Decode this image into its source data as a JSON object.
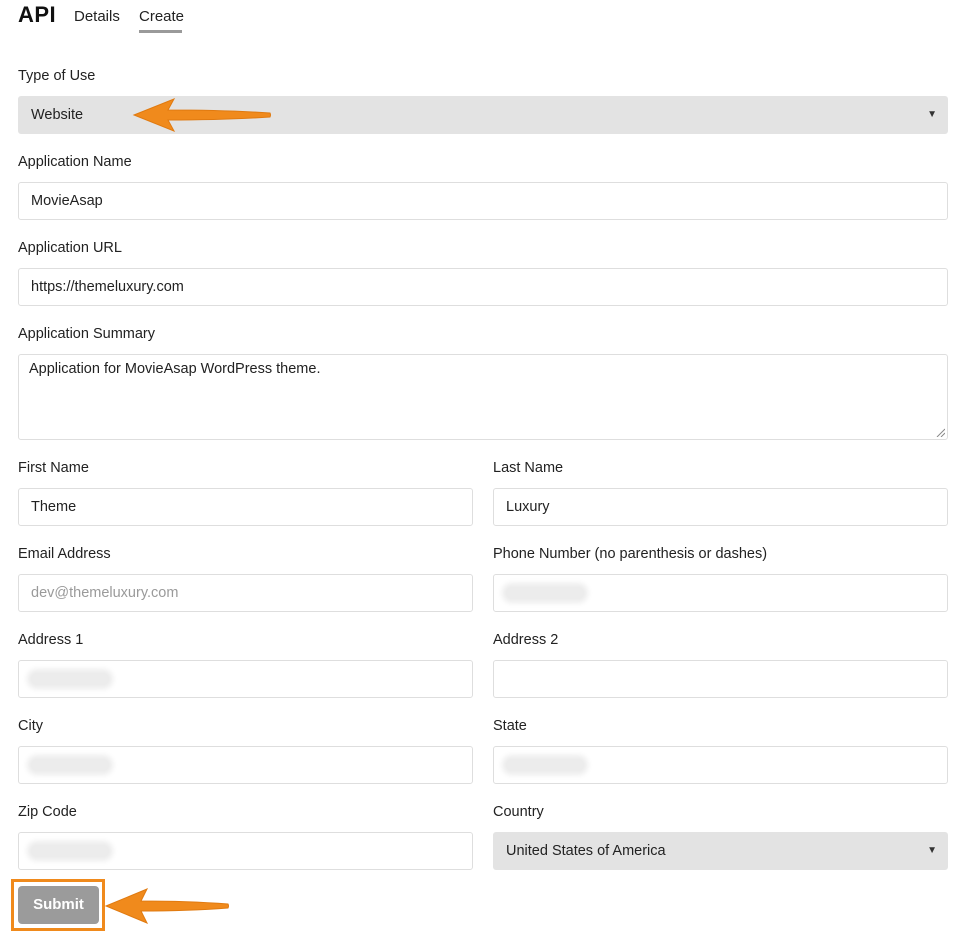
{
  "header": {
    "title": "API",
    "tabs": [
      {
        "label": "Details"
      },
      {
        "label": "Create",
        "active": true
      }
    ]
  },
  "form": {
    "type_of_use": {
      "label": "Type of Use",
      "value": "Website"
    },
    "app_name": {
      "label": "Application Name",
      "value": "MovieAsap"
    },
    "app_url": {
      "label": "Application URL",
      "value": "https://themeluxury.com"
    },
    "app_summary": {
      "label": "Application Summary",
      "value": "Application for MovieAsap WordPress theme."
    },
    "first_name": {
      "label": "First Name",
      "value": "Theme"
    },
    "last_name": {
      "label": "Last Name",
      "value": "Luxury"
    },
    "email": {
      "label": "Email Address",
      "placeholder": "dev@themeluxury.com"
    },
    "phone": {
      "label": "Phone Number (no parenthesis or dashes)"
    },
    "address1": {
      "label": "Address 1"
    },
    "address2": {
      "label": "Address 2"
    },
    "city": {
      "label": "City"
    },
    "state": {
      "label": "State"
    },
    "zip": {
      "label": "Zip Code"
    },
    "country": {
      "label": "Country",
      "value": "United States of America"
    },
    "submit_label": "Submit"
  },
  "colors": {
    "accent_orange": "#f08a1c",
    "select_bg": "#e3e3e3",
    "submit_bg": "#9b9b9b"
  },
  "icons": {
    "dropdown": "caret-down-icon",
    "annotation": "orange-arrow-icon"
  }
}
